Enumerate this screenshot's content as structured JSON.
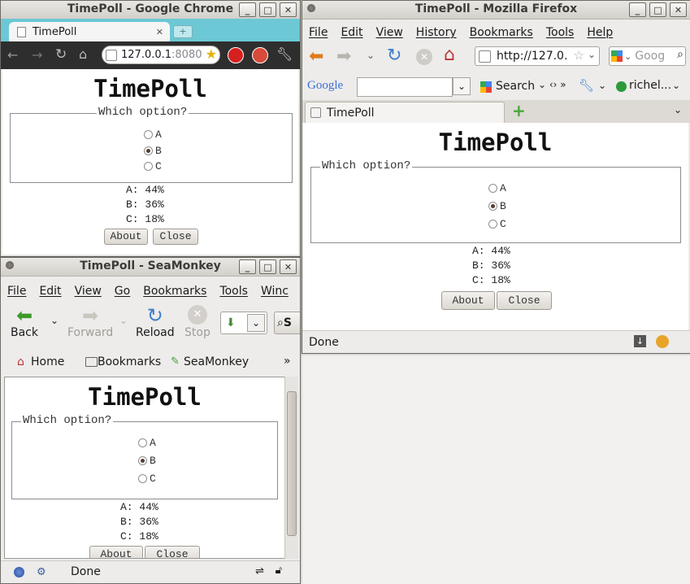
{
  "chrome": {
    "title": "TimePoll - Google Chrome",
    "tab_label": "TimePoll",
    "url_host": "127.0.0.1",
    "url_port": ":8080",
    "poll": {
      "title": "TimePoll",
      "legend": "Which option?",
      "options": [
        "A",
        "B",
        "C"
      ],
      "selected": "B",
      "results": [
        "A: 44%",
        "B: 36%",
        "C: 18%"
      ],
      "about": "About",
      "close": "Close"
    }
  },
  "firefox": {
    "title": "TimePoll - Mozilla Firefox",
    "menu": [
      "File",
      "Edit",
      "View",
      "History",
      "Bookmarks",
      "Tools",
      "Help"
    ],
    "url": "http://127.0.",
    "search_placeholder": "Goog",
    "google_label": "Google",
    "search_button": "Search",
    "user_label": "richel...",
    "tab_label": "TimePoll",
    "status": "Done",
    "poll": {
      "title": "TimePoll",
      "legend": "Which option?",
      "options": [
        "A",
        "B",
        "C"
      ],
      "selected": "B",
      "results": [
        "A: 44%",
        "B: 36%",
        "C: 18%"
      ],
      "about": "About",
      "close": "Close"
    }
  },
  "seamonkey": {
    "title": "TimePoll - SeaMonkey",
    "menu": [
      "File",
      "Edit",
      "View",
      "Go",
      "Bookmarks",
      "Tools",
      "Winc"
    ],
    "back": "Back",
    "forward": "Forward",
    "reload": "Reload",
    "stop": "Stop",
    "search_partial": "S",
    "bookmarks_bar": [
      "Home",
      "Bookmarks",
      "SeaMonkey"
    ],
    "status": "Done",
    "poll": {
      "title": "TimePoll",
      "legend": "Which option?",
      "options": [
        "A",
        "B",
        "C"
      ],
      "selected": "B",
      "results": [
        "A: 44%",
        "B: 36%",
        "C: 18%"
      ],
      "about": "About",
      "close": "Close"
    }
  },
  "colors": {
    "chrome_tabstrip": "#6cc8d5",
    "chrome_toolbar": "#2e2e2e",
    "radio_selected": "#5a3a2f"
  }
}
